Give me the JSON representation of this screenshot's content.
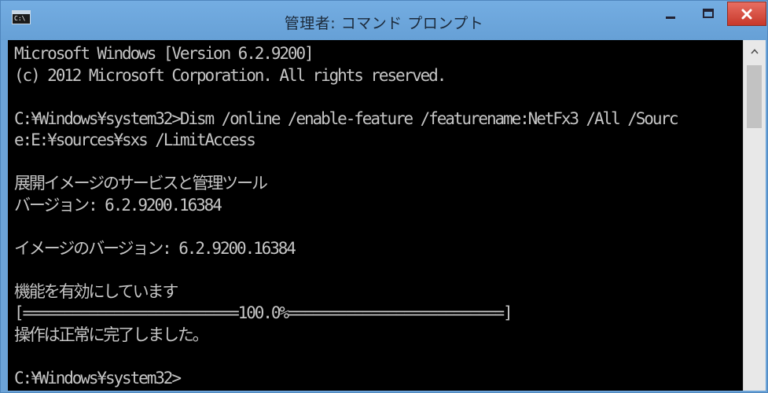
{
  "window": {
    "title": "管理者: コマンド プロンプト",
    "icon_text": "C:\\",
    "controls": {
      "minimize": "minimize",
      "maximize": "maximize",
      "close": "×"
    }
  },
  "console": {
    "lines": [
      "Microsoft Windows [Version 6.2.9200]",
      "(c) 2012 Microsoft Corporation. All rights reserved.",
      "",
      "C:¥Windows¥system32>Dism /online /enable-feature /featurename:NetFx3 /All /Sourc",
      "e:E:¥sources¥sxs /LimitAccess",
      "",
      "展開イメージのサービスと管理ツール",
      "バージョン: 6.2.9200.16384",
      "",
      "イメージのバージョン: 6.2.9200.16384",
      "",
      "機能を有効にしています",
      "[==========================100.0%==========================]",
      "操作は正常に完了しました。",
      "",
      "C:¥Windows¥system32>"
    ]
  },
  "scrollbar": {
    "up_arrow": "^"
  },
  "colors": {
    "titlebar": "#6ba3d8",
    "console_bg": "#000000",
    "console_text": "#c6c6c6",
    "close_button": "#d24b3e"
  }
}
